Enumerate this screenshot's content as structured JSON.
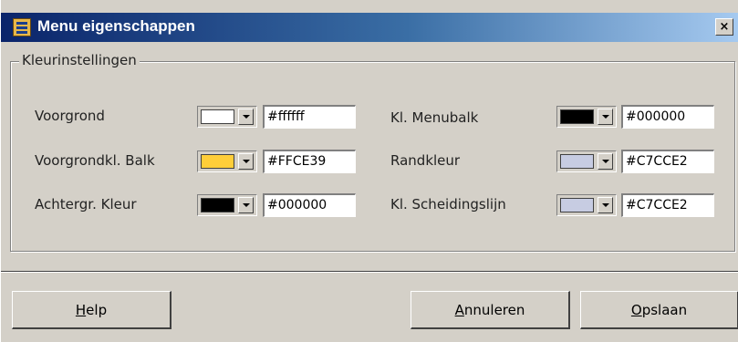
{
  "window": {
    "title": "Menu eigenschappen",
    "close_glyph": "×"
  },
  "group": {
    "title": "Kleurinstellingen"
  },
  "left": [
    {
      "label": "Voorgrond",
      "value": "#ffffff",
      "swatch": "#ffffff"
    },
    {
      "label": "Voorgrondkl. Balk",
      "value": "#FFCE39",
      "swatch": "#ffce39"
    },
    {
      "label": "Achtergr. Kleur",
      "value": "#000000",
      "swatch": "#000000"
    }
  ],
  "right": [
    {
      "label": "Kl. Menubalk",
      "value": "#000000",
      "swatch": "#000000"
    },
    {
      "label": "Randkleur",
      "value": "#C7CCE2",
      "swatch": "#c7cce2"
    },
    {
      "label": "Kl. Scheidingslijn",
      "value": "#C7CCE2",
      "swatch": "#c7cce2"
    }
  ],
  "buttons": {
    "help": {
      "mnemonic": "H",
      "rest": "elp"
    },
    "cancel": {
      "mnemonic": "A",
      "rest": "nnuleren"
    },
    "save": {
      "mnemonic": "O",
      "rest": "psla an"
    }
  },
  "icons": {
    "app": "menu-properties-icon",
    "close": "close-icon",
    "dropdown": "chevron-down-icon"
  }
}
